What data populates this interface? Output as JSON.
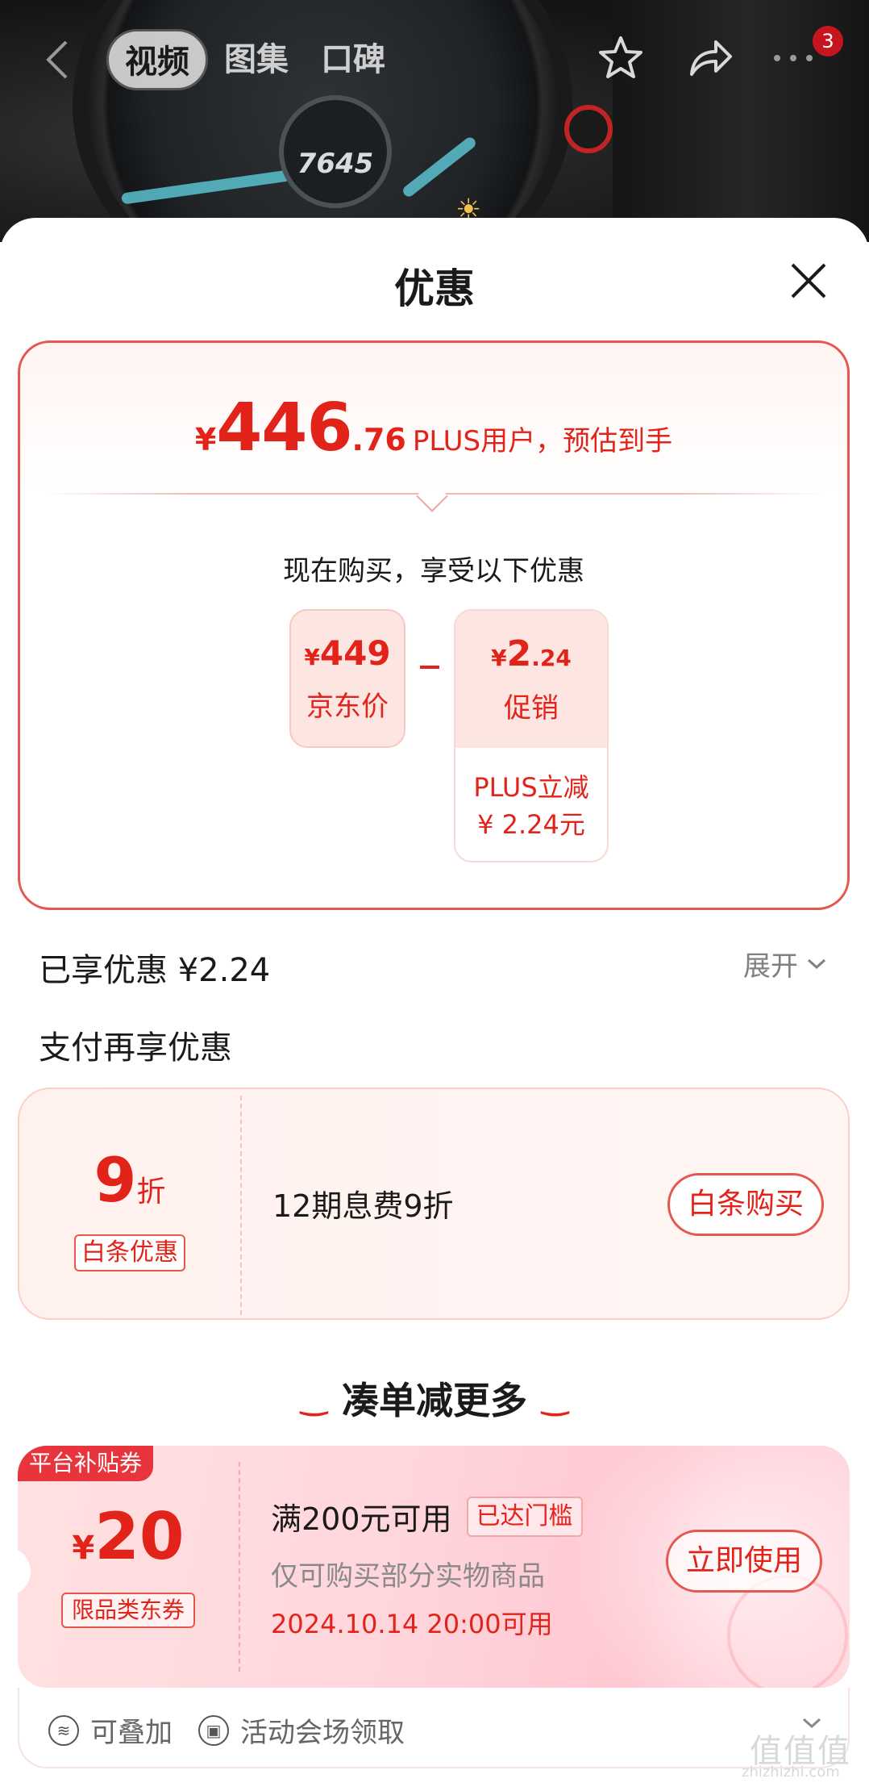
{
  "nav": {
    "tabs": [
      "视频",
      "图集",
      "口碑"
    ],
    "active_tab": 0,
    "cart_badge": "3"
  },
  "hero": {
    "step_count": "7645"
  },
  "sheet": {
    "title": "优惠"
  },
  "price_card": {
    "yen": "¥",
    "price_int": "446",
    "price_dec": ".76",
    "price_label": "PLUS用户，预估到手",
    "subtitle": "现在购买，享受以下优惠",
    "jd_price": {
      "yen": "¥",
      "amount": "449",
      "label": "京东价"
    },
    "promo": {
      "yen": "¥",
      "amount_int": "2",
      "amount_dec": ".24",
      "label": "促销",
      "detail_line1": "PLUS立减",
      "detail_line2": "¥ 2.24元"
    }
  },
  "enjoyed": {
    "label": "已享优惠 ¥2.24",
    "expand_label": "展开"
  },
  "pay_section": {
    "title": "支付再享优惠"
  },
  "baitiao": {
    "discount_num": "9",
    "discount_unit": "折",
    "tag": "白条优惠",
    "description": "12期息费9折",
    "button": "白条购买"
  },
  "more_section": {
    "title": "凑单减更多"
  },
  "coupon": {
    "ribbon": "平台补贴券",
    "yen": "¥",
    "amount": "20",
    "type": "限品类东券",
    "condition": "满200元可用",
    "reached_tag": "已达门槛",
    "scope": "仅可购买部分实物商品",
    "valid_time": "2024.10.14 20:00可用",
    "button": "立即使用",
    "footer_stackable": "可叠加",
    "footer_source": "活动会场领取"
  },
  "watermark": {
    "logo": "值值值",
    "url": "zhizhizhi.com"
  },
  "colors": {
    "accent": "#e2231a",
    "border": "#e6584f",
    "tint": "#fde6e2"
  },
  "icons": [
    "back-arrow-icon",
    "star-icon",
    "share-icon",
    "more-icon",
    "close-icon",
    "chevron-down-icon",
    "stack-icon",
    "ticket-icon"
  ]
}
